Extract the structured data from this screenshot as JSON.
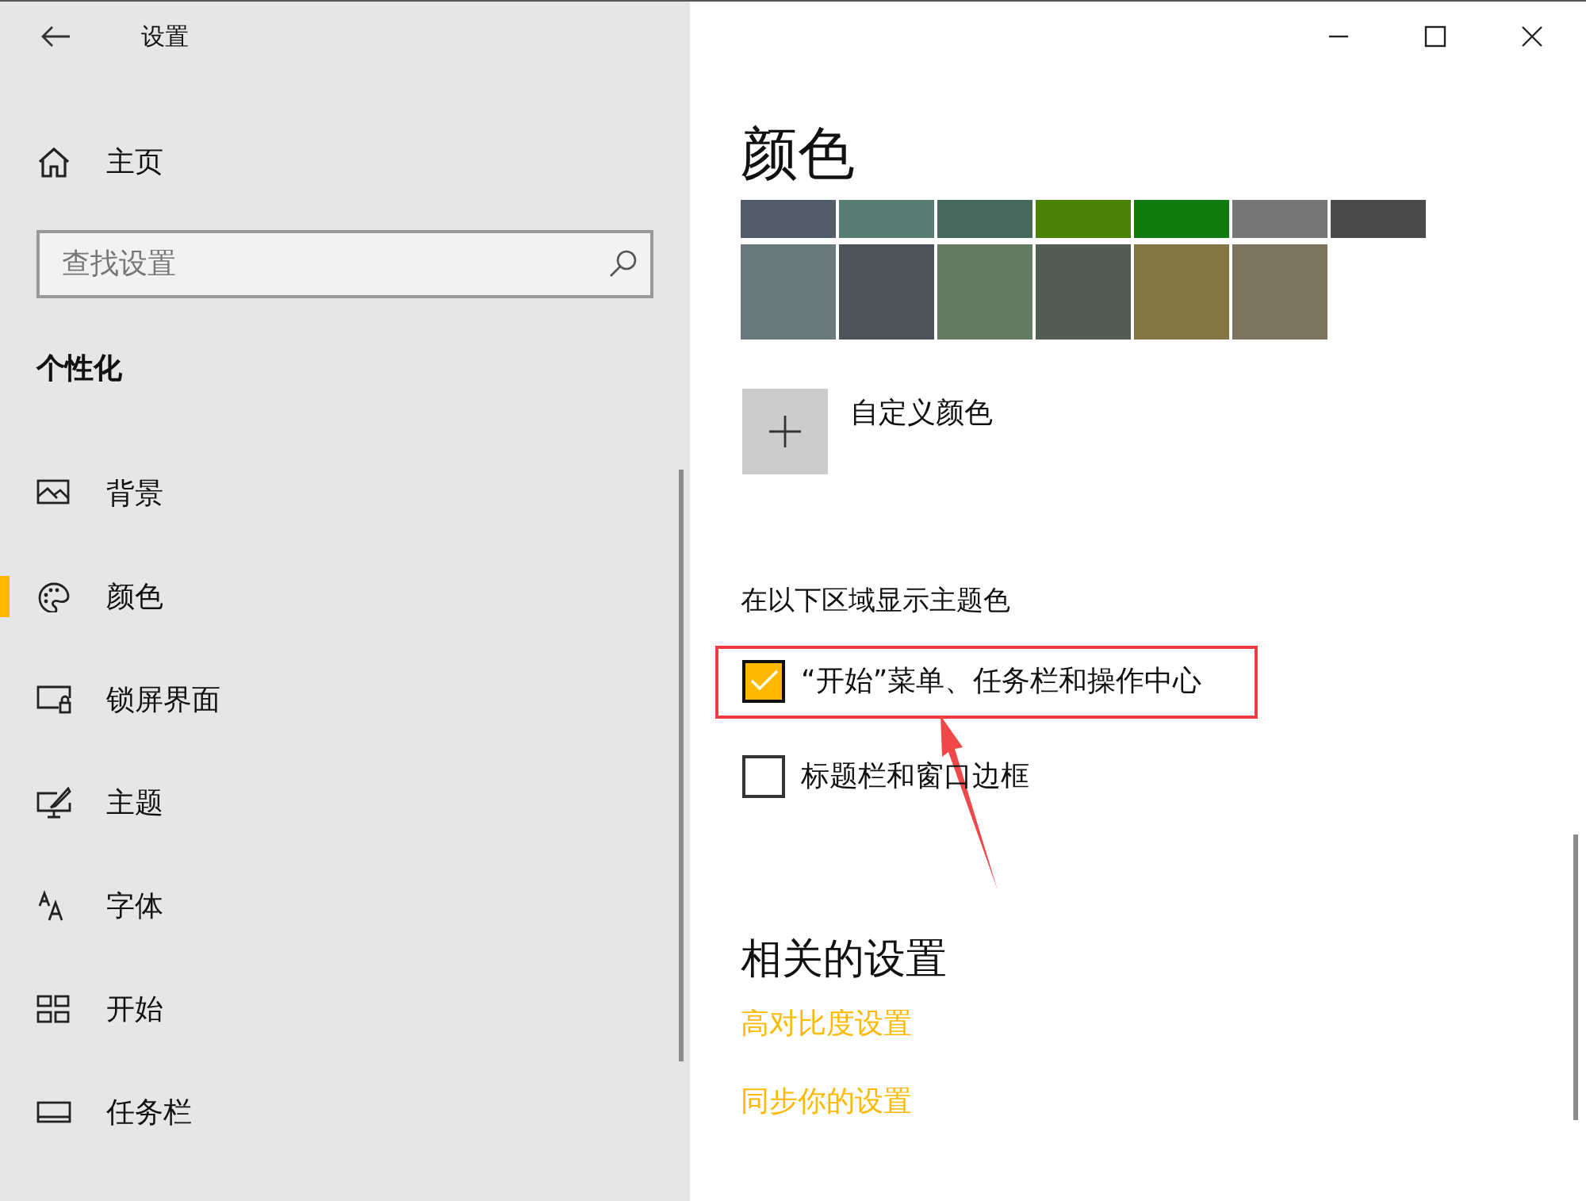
{
  "window": {
    "title": "设置"
  },
  "sidebar": {
    "home": "主页",
    "search": {
      "placeholder": "查找设置"
    },
    "section": "个性化",
    "items": [
      {
        "label": "背景",
        "selected": false
      },
      {
        "label": "颜色",
        "selected": true
      },
      {
        "label": "锁屏界面",
        "selected": false
      },
      {
        "label": "主题",
        "selected": false
      },
      {
        "label": "字体",
        "selected": false
      },
      {
        "label": "开始",
        "selected": false
      },
      {
        "label": "任务栏",
        "selected": false
      }
    ]
  },
  "content": {
    "heading": "颜色",
    "swatch_rows": [
      [
        {
          "color": "#515c6b"
        },
        {
          "color": "#567c73"
        },
        {
          "color": "#486860"
        },
        {
          "color": "#498205"
        },
        {
          "color": "#107c10"
        },
        {
          "color": "#767676"
        },
        {
          "color": "#4c4a48"
        }
      ],
      [
        {
          "color": "#69797e"
        },
        {
          "color": "#4a5459"
        },
        {
          "color": "#647c64"
        },
        {
          "color": "#525e54"
        },
        {
          "color": "#847545"
        },
        {
          "color": "#7e735f"
        }
      ]
    ],
    "custom_color": "自定义颜色",
    "accent_label": "在以下区域显示主题色",
    "checkboxes": [
      {
        "label": "“开始”菜单、任务栏和操作中心",
        "checked": true,
        "highlighted": true
      },
      {
        "label": "标题栏和窗口边框",
        "checked": false,
        "highlighted": false
      }
    ],
    "related_heading": "相关的设置",
    "links": [
      "高对比度设置",
      "同步你的设置"
    ]
  }
}
